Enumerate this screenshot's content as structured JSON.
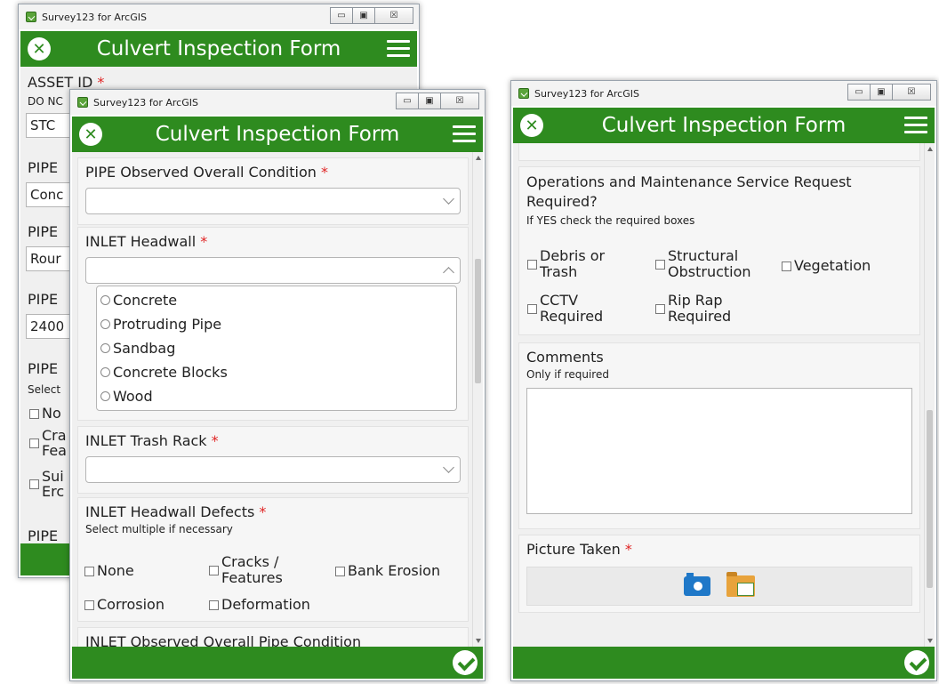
{
  "app_title": "Survey123 for ArcGIS",
  "form_title": "Culvert Inspection Form",
  "window_controls": {
    "minimize": "▭",
    "maximize": "▣",
    "close": "☒"
  },
  "back_window": {
    "asset_id_label": "ASSET ID",
    "asset_hint": "DO NC",
    "asset_value": "STC",
    "pipe1_label": "PIPE",
    "pipe1_value": "Conc",
    "pipe2_label": "PIPE",
    "pipe2_value": "Rour",
    "pipe3_label": "PIPE",
    "pipe3_value": "2400",
    "pipe4_label": "PIPE",
    "pipe4_hint": "Select",
    "opts": [
      "No",
      "Cra",
      "Fea",
      "Sui",
      "Erc"
    ],
    "pipe5_label": "PIPE"
  },
  "mid_window": {
    "q1": {
      "label": "PIPE Observed Overall Condition",
      "required": "*"
    },
    "q2": {
      "label": "INLET Headwall",
      "required": "*",
      "options": [
        "Concrete",
        "Protruding Pipe",
        "Sandbag",
        "Concrete Blocks",
        "Wood"
      ]
    },
    "q3": {
      "label": "INLET Trash Rack",
      "required": "*"
    },
    "q4": {
      "label": "INLET Headwall Defects",
      "required": "*",
      "hint": "Select multiple if necessary",
      "checks": [
        "None",
        "Cracks /\nFeatures",
        "Bank Erosion",
        "Corrosion",
        "Deformation"
      ]
    },
    "q5_partial": "INLET Observed Overall Pipe Condition"
  },
  "right_window": {
    "q1": {
      "label": "Operations and Maintenance Service Request Required?",
      "hint": "If YES check the required boxes",
      "checks": [
        "Debris or\nTrash",
        "Structural\nObstruction",
        "Vegetation",
        "CCTV\nRequired",
        "Rip Rap\nRequired"
      ]
    },
    "q2": {
      "label": "Comments",
      "hint": "Only if required"
    },
    "q3": {
      "label": "Picture Taken",
      "required": "*"
    }
  },
  "colors": {
    "header_green": "#2e8b1f",
    "required_red": "#e02424"
  }
}
